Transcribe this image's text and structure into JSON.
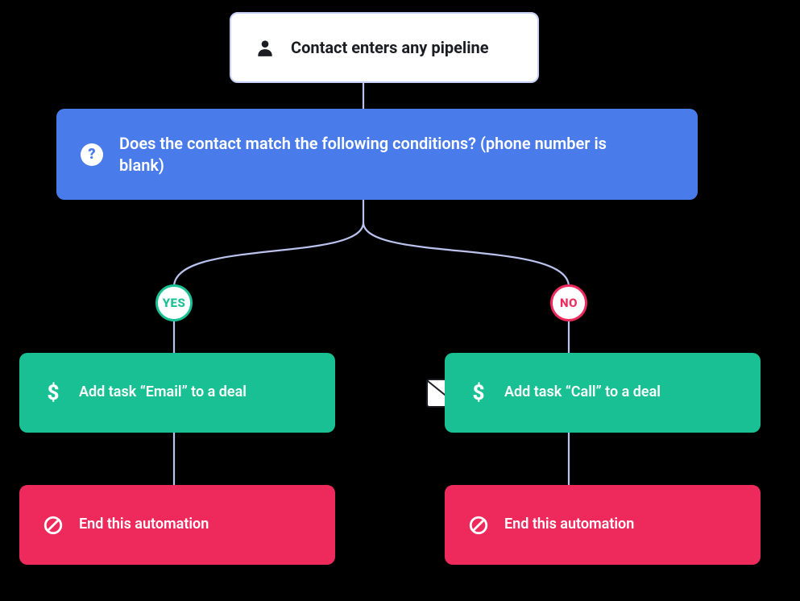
{
  "trigger": {
    "label": "Contact enters any pipeline",
    "icon": "person-icon"
  },
  "condition": {
    "label": "Does the contact match the following conditions? (phone number is blank)",
    "icon": "question-icon",
    "yes_label": "YES",
    "no_label": "NO"
  },
  "branches": {
    "yes": {
      "action": {
        "label": "Add task “Email” to a deal",
        "icon": "dollar-icon"
      },
      "end": {
        "label": "End this automation",
        "icon": "prohibit-icon"
      }
    },
    "no": {
      "action": {
        "label": "Add task “Call” to a deal",
        "icon": "dollar-icon",
        "bg_icon": "envelope-icon"
      },
      "end": {
        "label": "End this automation",
        "icon": "prohibit-icon"
      }
    }
  },
  "colors": {
    "trigger_border": "#c7d1f7",
    "condition_bg": "#4a7bea",
    "action_bg": "#19c093",
    "end_bg": "#ee2a5d",
    "connector": "#b9c3ee"
  }
}
